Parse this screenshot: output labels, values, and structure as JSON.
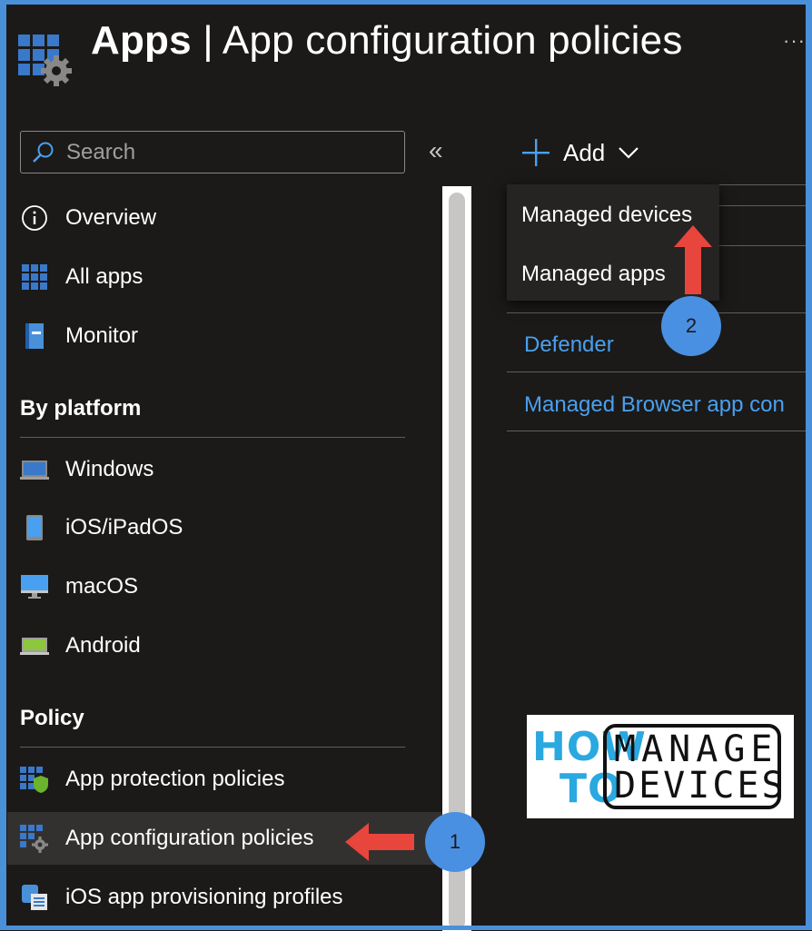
{
  "header": {
    "title_bold": "Apps",
    "title_sep": "|",
    "title_rest": "App configuration policies",
    "more_label": "···"
  },
  "search": {
    "placeholder": "Search"
  },
  "collapse_label": "«",
  "nav": {
    "overview": "Overview",
    "all_apps": "All apps",
    "monitor": "Monitor",
    "section_platform": "By platform",
    "windows": "Windows",
    "ios": "iOS/iPadOS",
    "macos": "macOS",
    "android": "Android",
    "section_policy": "Policy",
    "app_protection": "App protection policies",
    "app_configuration": "App configuration policies",
    "ios_provisioning": "iOS app provisioning profiles"
  },
  "toolbar": {
    "add_label": "Add"
  },
  "dropdown": {
    "items": [
      "Managed devices",
      "Managed apps"
    ]
  },
  "list": {
    "links": [
      "Defender",
      "Managed Browser app con"
    ]
  },
  "annotations": {
    "badge_1": "1",
    "badge_2": "2",
    "arrow_color": "#e8453c",
    "badge_color": "#4a90e2"
  },
  "logo": {
    "how": "HOW",
    "to": "TO",
    "manage": "MANAGE",
    "devices": "DEVICES"
  },
  "colors": {
    "background": "#1b1a19",
    "link": "#4aa0f0",
    "frame": "#4a90d9",
    "selected": "#323130"
  }
}
